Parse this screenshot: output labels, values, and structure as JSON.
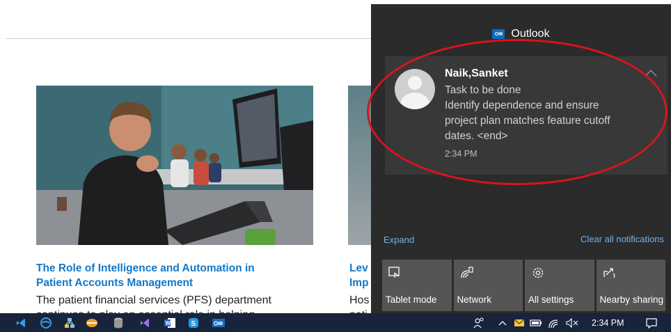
{
  "page": {
    "articles": [
      {
        "title_line1": "The Role of Intelligence and Automation in",
        "title_line2": "Patient Accounts Management",
        "desc_line1": "The patient financial services (PFS) department",
        "desc_line2": "continues to play an essential role in helping"
      },
      {
        "title_line1": "Lev",
        "title_line2": "Imp",
        "desc_line1": "Hos",
        "desc_line2": "pati"
      }
    ]
  },
  "action_center": {
    "app_title": "Outlook",
    "app_icon": "outlook-icon",
    "notification": {
      "sender": "Naik,Sanket",
      "subject": "Task to be done",
      "body_line1": "Identify dependence and ensure",
      "body_line2": "project plan matches feature cutoff",
      "body_line3": "dates. <end>",
      "time": "2:34 PM"
    },
    "expand_label": "Expand",
    "clear_all_label": "Clear all notifications",
    "quick_actions": [
      {
        "label": "Tablet mode",
        "icon": "tablet-mode-icon"
      },
      {
        "label": "Network",
        "icon": "network-icon"
      },
      {
        "label": "All settings",
        "icon": "gear-icon"
      },
      {
        "label": "Nearby sharing",
        "icon": "share-icon"
      }
    ]
  },
  "taskbar": {
    "apps": [
      "visual-studio-icon",
      "edge-browser-icon",
      "network-app-icon",
      "toolbox-icon",
      "database-icon",
      "visual-studio-icon",
      "word-icon",
      "skype-icon",
      "outlook-icon"
    ],
    "clock": "2:34 PM"
  },
  "colors": {
    "link": "#1278c8",
    "action_center_bg": "#2b2b2b",
    "annotation": "#d9141c",
    "taskbar_bg": "#18243b"
  }
}
